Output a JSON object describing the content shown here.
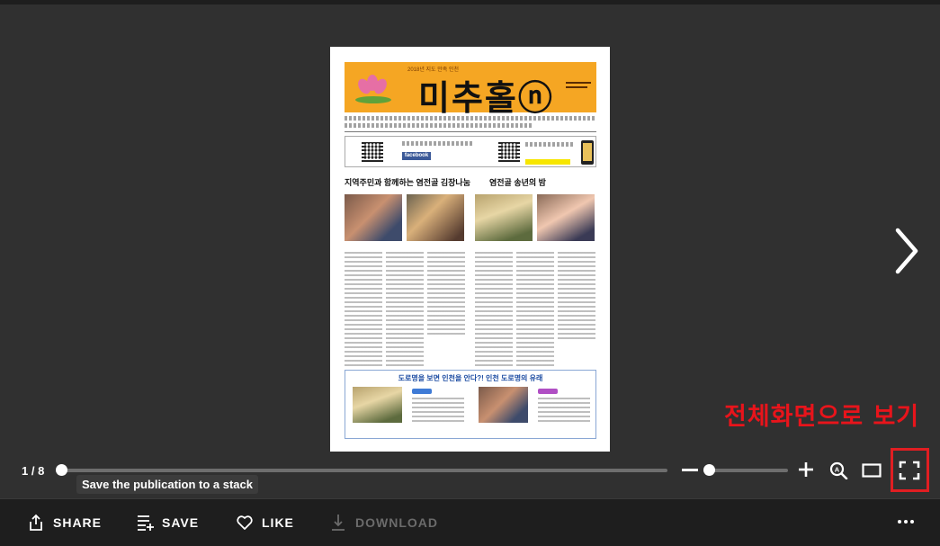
{
  "publication": {
    "masthead_title": "미추홀ⓝ",
    "masthead_tagline": "2018년 지도 만족 인천",
    "headline_left": "지역주민과 함께하는 염전골 김장나눔",
    "headline_right": "염전골 송년의 밤",
    "feature_title": "도로명을 보면 인천을 안다?! 인천 도로명의 유래",
    "facebook_label": "facebook"
  },
  "annotation": {
    "fullscreen_hint": "전체화면으로 보기",
    "highlight_color": "#e01e22"
  },
  "pager": {
    "page_indicator": "1 / 8",
    "current_page": 1,
    "total_pages": 8,
    "zoom_level": 0.0
  },
  "tooltip": {
    "text": "Save the publication to a stack"
  },
  "controls": {
    "icons": [
      "zoom-out-icon",
      "zoom-in-icon",
      "search-zoom-icon",
      "single-page-icon",
      "fullscreen-icon",
      "next-page-icon"
    ]
  },
  "actions": [
    {
      "label": "SHARE",
      "icon": "share-icon",
      "enabled": true
    },
    {
      "label": "SAVE",
      "icon": "stack-icon",
      "enabled": true
    },
    {
      "label": "LIKE",
      "icon": "heart-icon",
      "enabled": true
    },
    {
      "label": "DOWNLOAD",
      "icon": "download-icon",
      "enabled": false
    }
  ],
  "more": {
    "icon": "more-horizontal-icon"
  }
}
